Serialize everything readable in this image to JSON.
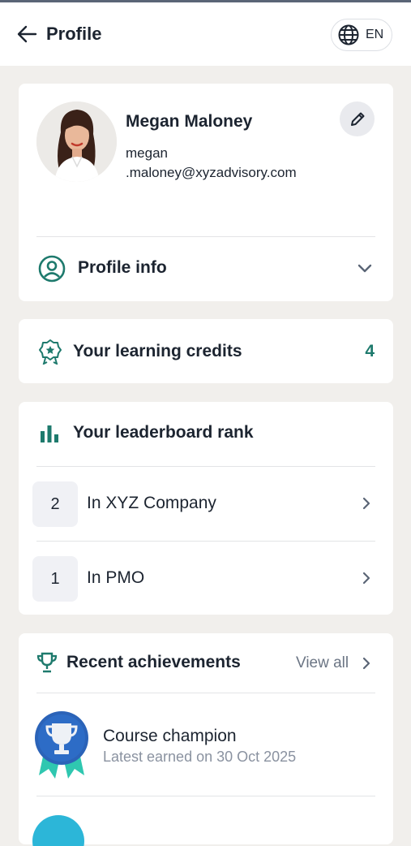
{
  "header": {
    "title": "Profile",
    "language": "EN"
  },
  "profile": {
    "name": "Megan Maloney",
    "email_line1": "megan",
    "email_line2": ".maloney@xyzadvisory.com",
    "profile_info_label": "Profile info"
  },
  "credits": {
    "label": "Your learning credits",
    "value": "4"
  },
  "leaderboard": {
    "title": "Your leaderboard rank",
    "rows": [
      {
        "rank": "2",
        "label": "In XYZ Company"
      },
      {
        "rank": "1",
        "label": "In PMO"
      }
    ]
  },
  "achievements": {
    "title": "Recent achievements",
    "view_all": "View all",
    "items": [
      {
        "title": "Course champion",
        "subtitle": "Latest earned on 30 Oct 2025",
        "icon": "trophy-badge-icon"
      }
    ]
  },
  "colors": {
    "accent": "#1e7a6d",
    "badge_blue": "#2b63b8",
    "ribbon": "#2fc7b0"
  }
}
